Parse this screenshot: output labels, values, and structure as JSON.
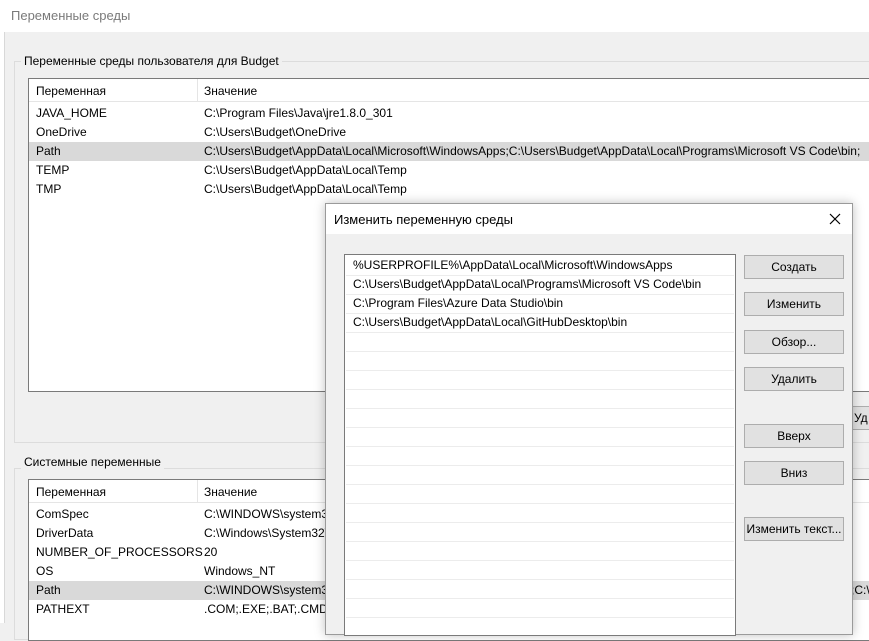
{
  "window": {
    "title": "Переменные среды"
  },
  "user_group": {
    "title": "Переменные среды пользователя для Budget",
    "columns": [
      "Переменная",
      "Значение"
    ],
    "rows": [
      {
        "name": "JAVA_HOME",
        "value": "C:\\Program Files\\Java\\jre1.8.0_301"
      },
      {
        "name": "OneDrive",
        "value": "C:\\Users\\Budget\\OneDrive"
      },
      {
        "name": "Path",
        "value": "C:\\Users\\Budget\\AppData\\Local\\Microsoft\\WindowsApps;C:\\Users\\Budget\\AppData\\Local\\Programs\\Microsoft VS Code\\bin;",
        "selected": true
      },
      {
        "name": "TEMP",
        "value": "C:\\Users\\Budget\\AppData\\Local\\Temp"
      },
      {
        "name": "TMP",
        "value": "C:\\Users\\Budget\\AppData\\Local\\Temp"
      }
    ],
    "cut_button_label": "Уд"
  },
  "system_group": {
    "title": "Системные переменные",
    "columns": [
      "Переменная",
      "Значение"
    ],
    "rows": [
      {
        "name": "ComSpec",
        "value": "C:\\WINDOWS\\system3"
      },
      {
        "name": "DriverData",
        "value": "C:\\Windows\\System32\\"
      },
      {
        "name": "NUMBER_OF_PROCESSORS",
        "value": "20"
      },
      {
        "name": "OS",
        "value": "Windows_NT"
      },
      {
        "name": "Path",
        "value": "C:\\WINDOWS\\system3",
        "selected": true,
        "tail": ";C:\\"
      },
      {
        "name": "PATHEXT",
        "value": ".COM;.EXE;.BAT;.CMD;."
      }
    ]
  },
  "dialog": {
    "title": "Изменить переменную среды",
    "paths": [
      "%USERPROFILE%\\AppData\\Local\\Microsoft\\WindowsApps",
      "C:\\Users\\Budget\\AppData\\Local\\Programs\\Microsoft VS Code\\bin",
      "C:\\Program Files\\Azure Data Studio\\bin",
      "C:\\Users\\Budget\\AppData\\Local\\GitHubDesktop\\bin",
      "",
      "",
      "",
      "",
      "",
      "",
      "",
      "",
      "",
      "",
      "",
      "",
      "",
      "",
      ""
    ],
    "buttons": {
      "new": "Создать",
      "edit": "Изменить",
      "browse": "Обзор...",
      "delete": "Удалить",
      "up": "Вверх",
      "down": "Вниз",
      "edit_text": "Изменить текст..."
    }
  }
}
